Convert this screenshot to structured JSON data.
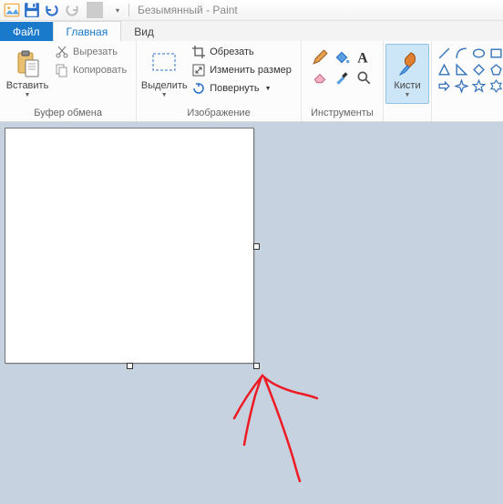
{
  "title": "Безымянный - Paint",
  "tabs": {
    "file": "Файл",
    "home": "Главная",
    "view": "Вид"
  },
  "clipboard": {
    "paste": "Вставить",
    "cut": "Вырезать",
    "copy": "Копировать",
    "group": "Буфер обмена"
  },
  "image": {
    "select": "Выделить",
    "crop": "Обрезать",
    "resize": "Изменить размер",
    "rotate": "Повернуть",
    "group": "Изображение"
  },
  "tools": {
    "group": "Инструменты"
  },
  "brushes": {
    "label": "Кисти"
  }
}
